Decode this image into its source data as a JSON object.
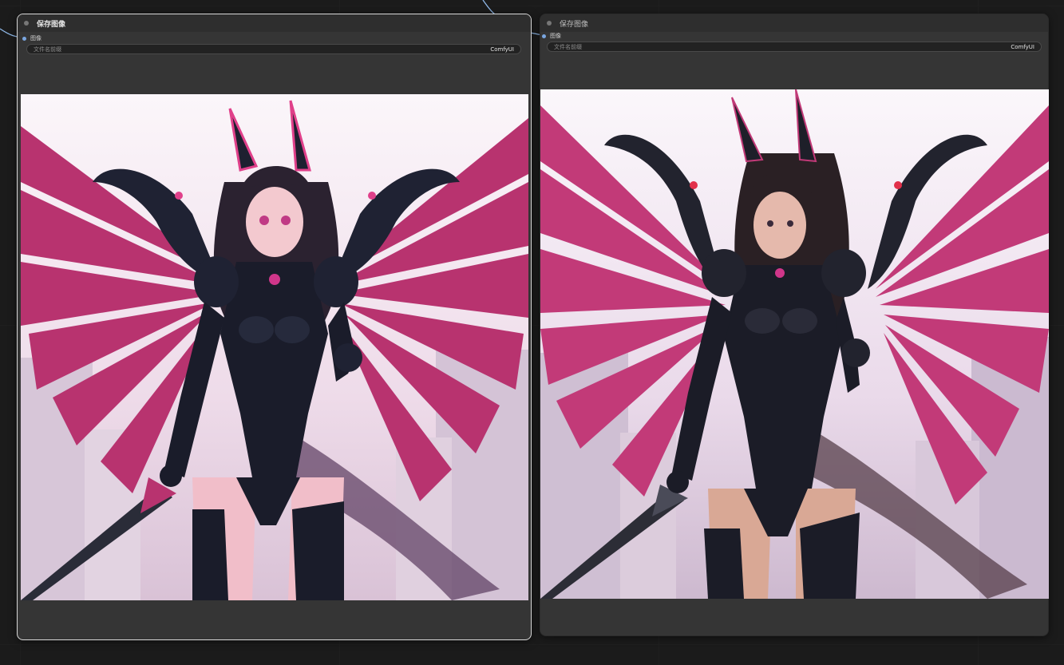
{
  "nodes": [
    {
      "title": "保存图像",
      "input_label": "图像",
      "widget_label": "文件名前缀",
      "widget_value": "ComfyUI",
      "preview": "anime-style winged armored warrior image"
    },
    {
      "title": "保存图像",
      "input_label": "图像",
      "widget_label": "文件名前缀",
      "widget_value": "ComfyUI",
      "preview": "photoreal winged armored warrior image"
    }
  ],
  "colors": {
    "canvas": "#1b1b1b",
    "node_bg": "#353535",
    "selected_outline": "#d9d9d9",
    "link": "#8fb8e8",
    "wing_pink": "#c23a78",
    "armor": "#1b1d2a"
  }
}
